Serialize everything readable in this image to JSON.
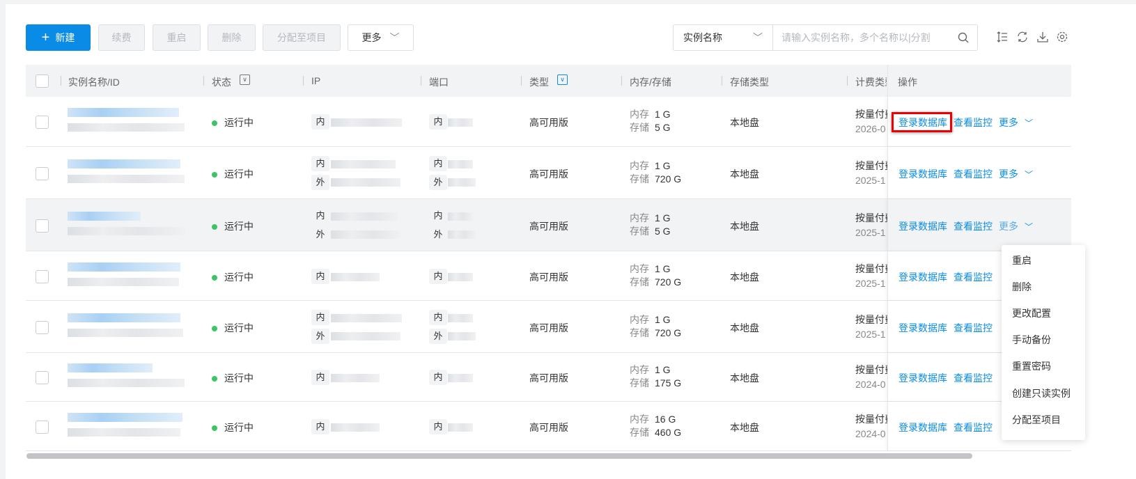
{
  "toolbar": {
    "new": "新建",
    "renew": "续费",
    "restart": "重启",
    "delete": "删除",
    "assign": "分配至项目",
    "more": "更多"
  },
  "search": {
    "field": "实例名称",
    "placeholder": "请输入实例名称，多个名称以|分割"
  },
  "columns": {
    "name": "实例名称/ID",
    "status": "状态",
    "ip": "IP",
    "port": "端口",
    "type": "类型",
    "mem": "内存/存储",
    "storage_type": "存储类型",
    "billing": "计费类型",
    "ops": "操作"
  },
  "labels": {
    "inner": "内",
    "outer": "外",
    "mem": "内存",
    "storage": "存储",
    "login": "登录数据库",
    "monitor": "查看监控",
    "more": "更多"
  },
  "rows": [
    {
      "status": "运行中",
      "has_outer": false,
      "type": "高可用版",
      "mem": "1 G",
      "storage": "5 G",
      "storage_type": "本地盘",
      "billing": "按量付费",
      "date": "2026-0",
      "more": true
    },
    {
      "status": "运行中",
      "has_outer": true,
      "type": "高可用版",
      "mem": "1 G",
      "storage": "720 G",
      "storage_type": "本地盘",
      "billing": "按量付费",
      "date": "2025-1",
      "more": true
    },
    {
      "status": "运行中",
      "has_outer": true,
      "type": "高可用版",
      "mem": "1 G",
      "storage": "5 G",
      "storage_type": "本地盘",
      "billing": "按量付费",
      "date": "2025-1",
      "more": true
    },
    {
      "status": "运行中",
      "has_outer": false,
      "type": "高可用版",
      "mem": "1 G",
      "storage": "720 G",
      "storage_type": "本地盘",
      "billing": "按量付费",
      "date": "2025-1",
      "more": false
    },
    {
      "status": "运行中",
      "has_outer": true,
      "type": "高可用版",
      "mem": "1 G",
      "storage": "720 G",
      "storage_type": "本地盘",
      "billing": "按量付费",
      "date": "2025-1",
      "more": false
    },
    {
      "status": "运行中",
      "has_outer": false,
      "type": "高可用版",
      "mem": "1 G",
      "storage": "175 G",
      "storage_type": "本地盘",
      "billing": "按量付费",
      "date": "2024-0",
      "more": false
    },
    {
      "status": "运行中",
      "has_outer": false,
      "type": "高可用版",
      "mem": "16 G",
      "storage": "460 G",
      "storage_type": "本地盘",
      "billing": "按量付费",
      "date": "2024-0",
      "more": false
    }
  ],
  "more_menu": [
    "重启",
    "删除",
    "更改配置",
    "手动备份",
    "重置密码",
    "创建只读实例",
    "分配至项目"
  ],
  "colors": {
    "primary": "#0a8ce6",
    "running": "#3ec466",
    "highlight": "#ee0000"
  }
}
